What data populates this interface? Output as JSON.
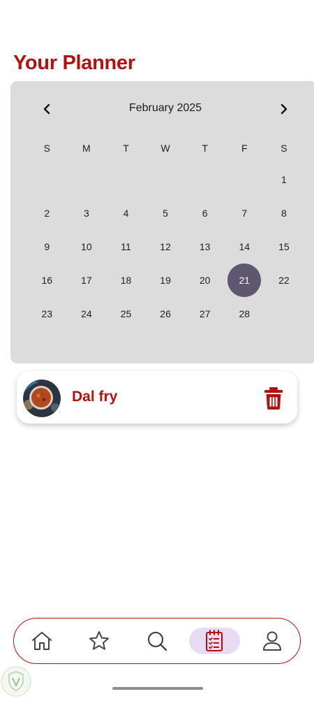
{
  "page": {
    "title": "Your Planner"
  },
  "calendar": {
    "month_label": "February 2025",
    "prev_icon": "chevron-left-icon",
    "next_icon": "chevron-right-icon",
    "weekdays": [
      "S",
      "M",
      "T",
      "W",
      "T",
      "F",
      "S"
    ],
    "weeks": [
      [
        "",
        "",
        "",
        "",
        "",
        "",
        "1"
      ],
      [
        "2",
        "3",
        "4",
        "5",
        "6",
        "7",
        "8"
      ],
      [
        "9",
        "10",
        "11",
        "12",
        "13",
        "14",
        "15"
      ],
      [
        "16",
        "17",
        "18",
        "19",
        "20",
        "21",
        "22"
      ],
      [
        "23",
        "24",
        "25",
        "26",
        "27",
        "28",
        ""
      ]
    ],
    "selected_day": "21",
    "selected_color": "#5f566f"
  },
  "planned_meals": [
    {
      "name": "Dal fry",
      "image_icon": "dal-fry-photo",
      "action_icon": "trash-icon"
    }
  ],
  "bottom_nav": {
    "items": [
      {
        "icon": "home-icon"
      },
      {
        "icon": "star-icon"
      },
      {
        "icon": "search-icon"
      },
      {
        "icon": "planner-icon",
        "active": true
      },
      {
        "icon": "profile-icon"
      }
    ],
    "accent_color": "#b3100f",
    "active_bg": "#e7dcf3"
  }
}
